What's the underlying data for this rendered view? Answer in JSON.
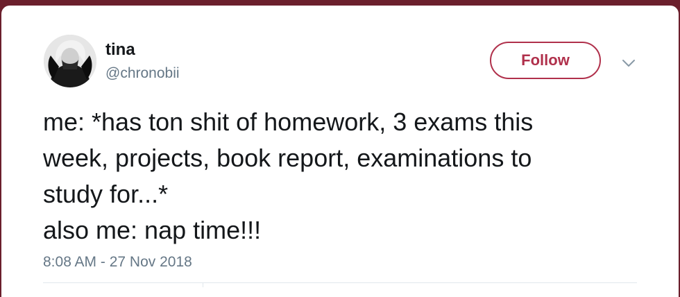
{
  "user": {
    "name": "tina",
    "handle": "@chronobii",
    "avatar_icon": "profile-photo"
  },
  "actions": {
    "follow_label": "Follow",
    "menu_icon": "chevron-down-icon",
    "accent_color": "#b0304b"
  },
  "tweet": {
    "lines": [
      "me: *has ton shit of homework, 3 exams this",
      "week, projects, book report, examinations to",
      "study for...*",
      "also me: nap time!!!"
    ],
    "timestamp": "8:08 AM - 27 Nov 2018"
  }
}
